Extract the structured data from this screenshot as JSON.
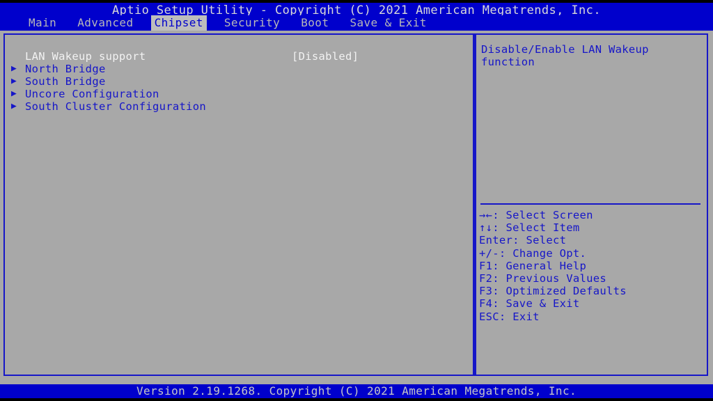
{
  "header": {
    "title": "Aptio Setup Utility - Copyright (C) 2021 American Megatrends, Inc."
  },
  "menu": {
    "items": [
      {
        "label": "Main",
        "active": false
      },
      {
        "label": "Advanced",
        "active": false
      },
      {
        "label": "Chipset",
        "active": true
      },
      {
        "label": "Security",
        "active": false
      },
      {
        "label": "Boot",
        "active": false
      },
      {
        "label": "Save & Exit",
        "active": false
      }
    ]
  },
  "main": {
    "items": [
      {
        "marker": "",
        "label": "LAN Wakeup support",
        "value": "[Disabled]",
        "selected": true,
        "submenu": false
      },
      {
        "marker": "▶",
        "label": "North Bridge",
        "value": "",
        "selected": false,
        "submenu": true
      },
      {
        "marker": "▶",
        "label": "South Bridge",
        "value": "",
        "selected": false,
        "submenu": true
      },
      {
        "marker": "▶",
        "label": "Uncore Configuration",
        "value": "",
        "selected": false,
        "submenu": true
      },
      {
        "marker": "▶",
        "label": "South Cluster Configuration",
        "value": "",
        "selected": false,
        "submenu": true
      }
    ]
  },
  "help": {
    "description": "Disable/Enable LAN Wakeup function",
    "nav_keys": [
      {
        "keys": "→←",
        "sep": ":",
        "action": "Select Screen"
      },
      {
        "keys": "↑↓",
        "sep": ":",
        "action": "Select Item"
      },
      {
        "keys": "Enter",
        "sep": ":",
        "action": "Select"
      },
      {
        "keys": "+/-",
        "sep": ":",
        "action": "Change Opt."
      },
      {
        "keys": "F1",
        "sep": ":",
        "action": "General Help"
      },
      {
        "keys": "F2",
        "sep": ":",
        "action": "Previous Values"
      },
      {
        "keys": "F3",
        "sep": ":",
        "action": "Optimized Defaults"
      },
      {
        "keys": "F4",
        "sep": ":",
        "action": "Save & Exit"
      },
      {
        "keys": "ESC",
        "sep": ":",
        "action": "Exit"
      }
    ]
  },
  "footer": {
    "version": "Version 2.19.1268. Copyright (C) 2021 American Megatrends, Inc."
  },
  "colors": {
    "band_blue": "#0000cc",
    "text_blue": "#1616c8",
    "desktop_gray": "#a8a8a8",
    "tab_active_bg": "#bdbdbd",
    "text_white": "#f2f2f2",
    "band_text": "#d8d8d8"
  }
}
